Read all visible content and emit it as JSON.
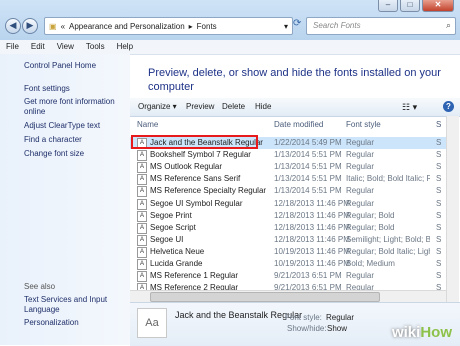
{
  "addressbar": {
    "crumb1": "Appearance and Personalization",
    "sep": "▸",
    "crumb2": "Fonts",
    "search_placeholder": "Search Fonts"
  },
  "menu": [
    "File",
    "Edit",
    "View",
    "Tools",
    "Help"
  ],
  "left_pane": {
    "home": "Control Panel Home",
    "links": [
      "Font settings",
      "Get more font information online",
      "Adjust ClearType text",
      "Find a character",
      "Change font size"
    ],
    "see_also": "See also",
    "see_also_links": [
      "Text Services and Input Language",
      "Personalization"
    ]
  },
  "main": {
    "heading": "Preview, delete, or show and hide the fonts installed on your computer",
    "toolbar": {
      "organize": "Organize ▾",
      "preview": "Preview",
      "delete": "Delete",
      "hide": "Hide",
      "help": "?"
    },
    "columns": [
      "Name",
      "Date modified",
      "Font style",
      "S"
    ],
    "rows": [
      {
        "name": "Jack and the Beanstalk Regular",
        "date": "1/22/2014 5:49 PM",
        "style": "Regular",
        "s": "S"
      },
      {
        "name": "Bookshelf Symbol 7 Regular",
        "date": "1/13/2014 5:51 PM",
        "style": "Regular",
        "s": "S"
      },
      {
        "name": "MS Outlook Regular",
        "date": "1/13/2014 5:51 PM",
        "style": "Regular",
        "s": "S"
      },
      {
        "name": "MS Reference Sans Serif",
        "date": "1/13/2014 5:51 PM",
        "style": "Italic; Bold; Bold Italic; R...",
        "s": "S"
      },
      {
        "name": "MS Reference Specialty Regular",
        "date": "1/13/2014 5:51 PM",
        "style": "Regular",
        "s": "S"
      },
      {
        "name": "Segoe UI Symbol Regular",
        "date": "12/18/2013 11:46 PM",
        "style": "Regular",
        "s": "S"
      },
      {
        "name": "Segoe Print",
        "date": "12/18/2013 11:46 PM",
        "style": "Regular; Bold",
        "s": "S"
      },
      {
        "name": "Segoe Script",
        "date": "12/18/2013 11:46 PM",
        "style": "Regular; Bold",
        "s": "S"
      },
      {
        "name": "Segoe UI",
        "date": "12/18/2013 11:46 PM",
        "style": "Semilight; Light; Bold; Bol...",
        "s": "S"
      },
      {
        "name": "Helvetica Neue",
        "date": "10/19/2013 11:46 PM",
        "style": "Regular; Bold Italic; Ligh...",
        "s": "S"
      },
      {
        "name": "Lucida Grande",
        "date": "10/19/2013 11:46 PM",
        "style": "Bold; Medium",
        "s": "S"
      },
      {
        "name": "MS Reference 1 Regular",
        "date": "9/21/2013 6:51 PM",
        "style": "Regular",
        "s": "S"
      },
      {
        "name": "MS Reference 2 Regular",
        "date": "9/21/2013 6:51 PM",
        "style": "Regular",
        "s": "S"
      }
    ]
  },
  "details": {
    "name": "Jack and the Beanstalk Regular",
    "style_label": "Font style:",
    "style_value": "Regular",
    "show_label": "Show/hide:",
    "show_value": "Show"
  },
  "watermark": {
    "wiki": "wiki",
    "how": "How"
  },
  "colors": {
    "accent": "#1e3287",
    "selection": "#cde5fa",
    "highlight_box": "#e8191b"
  }
}
